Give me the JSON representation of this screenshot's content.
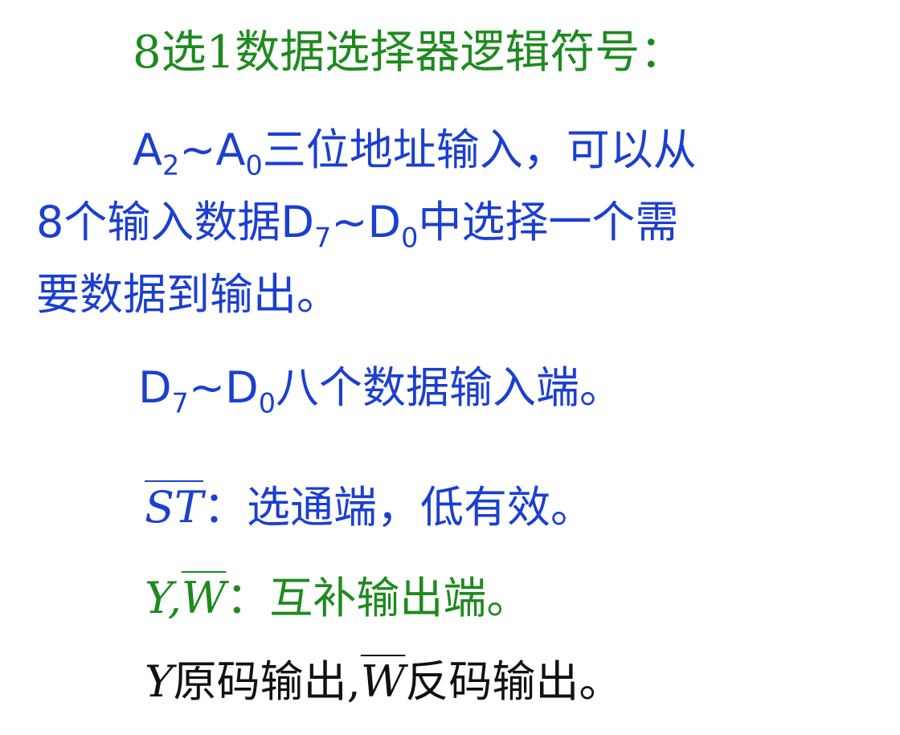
{
  "title": "8选1数据选择器逻辑符号：",
  "paragraph1": {
    "a2_letter": "A",
    "a2_sub": "2",
    "tilde": "~",
    "a0_letter": "A",
    "a0_sub": "0",
    "line1_text": "三位地址输入，可以从",
    "line2_prefix": "8个输入数据",
    "d7_letter": "D",
    "d7_sub": "7",
    "tilde2": "~",
    "d0_letter": "D",
    "d0_sub": "0",
    "line2_text": "中选择一个需",
    "line3_text": "要数据到输出。"
  },
  "data_inputs": {
    "d7_letter": "D",
    "d7_sub": "7",
    "tilde": "~",
    "d0_letter": "D",
    "d0_sub": "0",
    "text": "八个数据输入端。"
  },
  "strobe": {
    "symbol": "ST",
    "colon": "：",
    "text": "选通端，低有效。"
  },
  "outputs": {
    "y_symbol": "Y",
    "comma": ",",
    "w_symbol": "W",
    "colon": "：",
    "text": "互补输出端。"
  },
  "output_desc": {
    "y_symbol": "Y",
    "y_text": "原码输出",
    "comma": ",",
    "w_symbol": "W",
    "w_text": "反码输出。"
  },
  "colors": {
    "green": "#1e8a1e",
    "blue": "#1b3fd1",
    "black": "#111111"
  }
}
